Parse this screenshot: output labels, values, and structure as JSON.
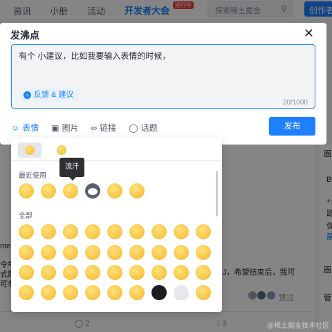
{
  "nav": {
    "items": [
      "资讯",
      "小册",
      "活动"
    ],
    "brand": "开发者大会",
    "brand_badge": "进行中",
    "search_placeholder": "探索稀土掘金",
    "creator": "创作者"
  },
  "background": {
    "lines": [
      "令举",
      "式题",
      "可有",
      "nter"
    ],
    "note": "J，希望结束后，我可",
    "passed": "赞过",
    "comment_count": "2",
    "like_count": "3",
    "right_items": [
      "圈",
      "Bu",
      "+是",
      "路",
      "优",
      "展",
      "圈",
      "管"
    ]
  },
  "dialog": {
    "title": "发沸点",
    "editor_text": "有个  小建议，比如我要输入表情的时候，",
    "topic": "反馈 & 建议",
    "counter": "20/1000",
    "tools": [
      {
        "label": "表情",
        "icon": "emoji-icon"
      },
      {
        "label": "图片",
        "icon": "image-icon"
      },
      {
        "label": "链接",
        "icon": "link-icon"
      },
      {
        "label": "话题",
        "icon": "topic-icon"
      }
    ],
    "publish": "发布"
  },
  "emoji_panel": {
    "recent_label": "最近使用",
    "all_label": "全部",
    "tooltip": "流汗"
  },
  "watermark": "@稀土掘金技术社区",
  "colors": {
    "accent": "#1e80ff",
    "overlay": "rgba(0,0,0,0.48)"
  }
}
